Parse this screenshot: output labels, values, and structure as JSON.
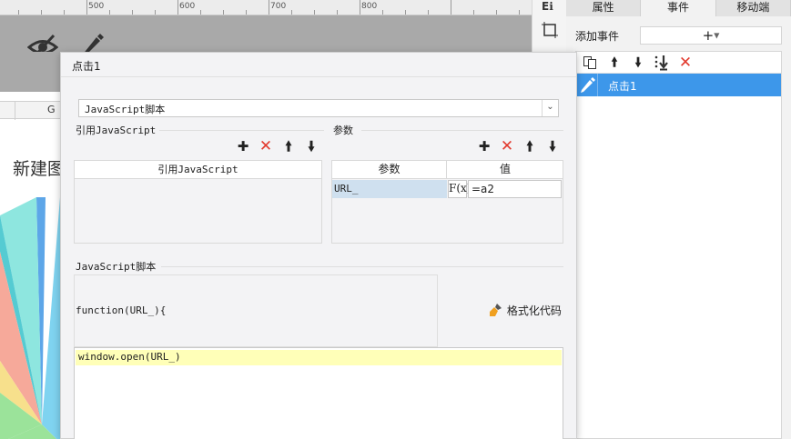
{
  "ruler": {
    "labels": [
      "500",
      "600",
      "700",
      "800"
    ]
  },
  "sheet": {
    "column_label": "G",
    "chart_title": "新建图"
  },
  "right_panel": {
    "tabs": [
      "属性",
      "事件",
      "移动端"
    ],
    "active_tab": "事件",
    "add_event_label": "添加事件",
    "add_event_button": "+",
    "events": [
      {
        "label": "点击1",
        "selected": true
      }
    ],
    "toolbar_icons": [
      "copy-icon",
      "arrow-up-icon",
      "arrow-down-icon",
      "move-bottom-icon",
      "delete-icon"
    ]
  },
  "dialog": {
    "title": "点击1",
    "type_select": {
      "value": "JavaScript脚本"
    },
    "ref_section": {
      "title": "引用JavaScript",
      "column_header": "引用JavaScript",
      "rows": []
    },
    "param_section": {
      "title": "参数",
      "columns": [
        "参数",
        "值"
      ],
      "rows": [
        {
          "name": "URL_",
          "formula_label": "F(x)",
          "value": "=a2"
        }
      ]
    },
    "script_section": {
      "title": "JavaScript脚本",
      "function_header": "function(URL_){",
      "format_button": "格式化代码",
      "code_lines": [
        "window.open(URL_)"
      ]
    }
  },
  "colors": {
    "accent": "#3d97ea",
    "delete": "#e23a2e",
    "highlight_line": "#ffffb8",
    "param_name_bg": "#cfe0ef"
  }
}
